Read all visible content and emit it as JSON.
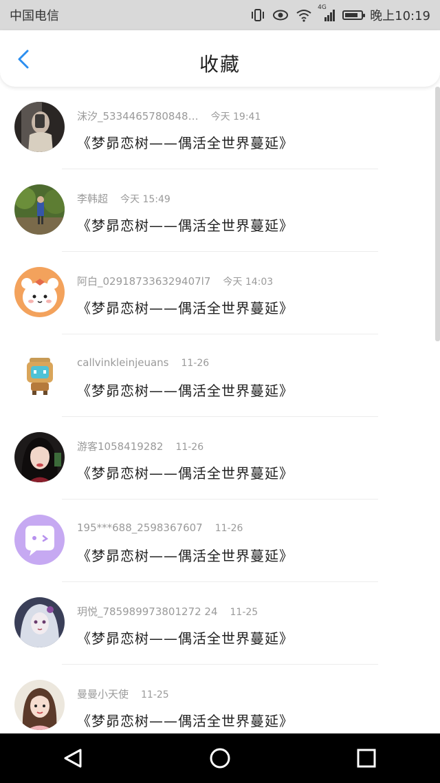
{
  "status_bar": {
    "carrier": "中国电信",
    "network": "4G",
    "time": "晚上10:19",
    "battery_level": 0.8
  },
  "header": {
    "title": "收藏",
    "back_icon": "chevron-left-icon",
    "accent": "#2b8ef0"
  },
  "favorites": [
    {
      "user": "沫汐_5334465780848…",
      "time": "今天 19:41",
      "title": "《梦昴恋树——偶活全世界蔓延》"
    },
    {
      "user": "李韩超",
      "time": "今天 15:49",
      "title": "《梦昴恋树——偶活全世界蔓延》"
    },
    {
      "user": "阿白_029187336329407l7",
      "time": "今天 14:03",
      "title": "《梦昴恋树——偶活全世界蔓延》"
    },
    {
      "user": "callvinkleinjeuans",
      "time": "11-26",
      "title": "《梦昴恋树——偶活全世界蔓延》"
    },
    {
      "user": "游客1058419282",
      "time": "11-26",
      "title": "《梦昴恋树——偶活全世界蔓延》"
    },
    {
      "user": "195***688_2598367607",
      "time": "11-26",
      "title": "《梦昴恋树——偶活全世界蔓延》"
    },
    {
      "user": "玥悦_785989973801272 24",
      "time": "11-25",
      "title": "《梦昴恋树——偶活全世界蔓延》"
    },
    {
      "user": "曼曼小天使",
      "time": "11-25",
      "title": "《梦昴恋树——偶活全世界蔓延》"
    }
  ],
  "system_nav": {
    "back_icon": "triangle-back-icon",
    "home_icon": "circle-home-icon",
    "recents_icon": "square-recents-icon"
  }
}
